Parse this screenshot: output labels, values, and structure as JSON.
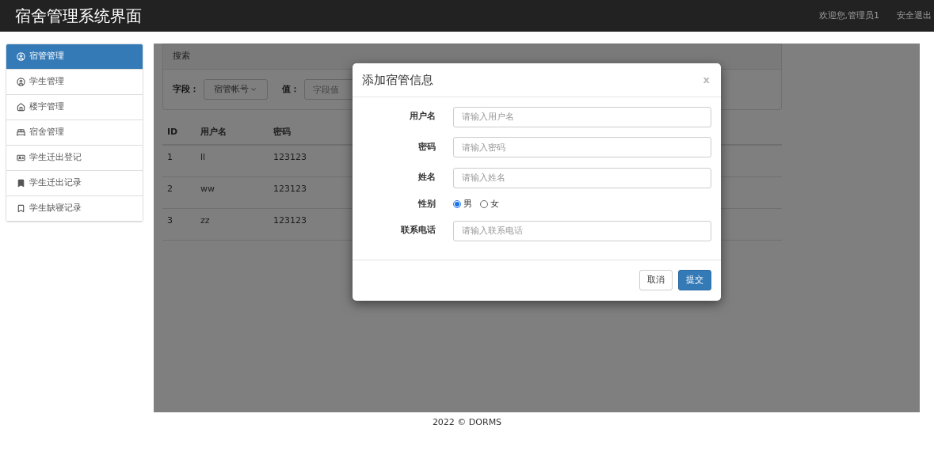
{
  "navbar": {
    "title": "宿舍管理系统界面",
    "welcome": "欢迎您,管理员1",
    "logout": "安全退出"
  },
  "sidebar": {
    "items": [
      {
        "label": "宿管管理",
        "selected": true
      },
      {
        "label": "学生管理",
        "selected": false
      },
      {
        "label": "楼宇管理",
        "selected": false
      },
      {
        "label": "宿舍管理",
        "selected": false
      },
      {
        "label": "学生迁出登记",
        "selected": false
      },
      {
        "label": "学生迁出记录",
        "selected": false
      },
      {
        "label": "学生缺寝记录",
        "selected": false
      }
    ]
  },
  "search_panel": {
    "heading": "搜索",
    "field_label": "字段：",
    "field_value": "宿管帐号",
    "value_label": "值：",
    "value_placeholder": "字段值"
  },
  "table": {
    "columns": [
      "ID",
      "用户名",
      "密码"
    ],
    "rows": [
      [
        "1",
        "ll",
        "123123"
      ],
      [
        "2",
        "ww",
        "123123"
      ],
      [
        "3",
        "zz",
        "123123"
      ]
    ]
  },
  "dialog": {
    "title": "添加宿管信息",
    "close": "x",
    "fields": [
      {
        "kind": "text",
        "label": "用户名",
        "placeholder": "请输入用户名"
      },
      {
        "kind": "text",
        "label": "密码",
        "placeholder": "请输入密码"
      },
      {
        "kind": "text",
        "label": "姓名",
        "placeholder": "请输入姓名"
      },
      {
        "kind": "radio",
        "label": "性别",
        "options": [
          {
            "label": "男",
            "selected": true
          },
          {
            "label": "女",
            "selected": false
          }
        ]
      },
      {
        "kind": "text",
        "label": "联系电话",
        "placeholder": "请输入联系电话"
      }
    ],
    "buttons": [
      {
        "label": "取消",
        "kind": "default"
      },
      {
        "label": "提交",
        "kind": "primary"
      }
    ]
  },
  "footer": "2022 © DORMS"
}
